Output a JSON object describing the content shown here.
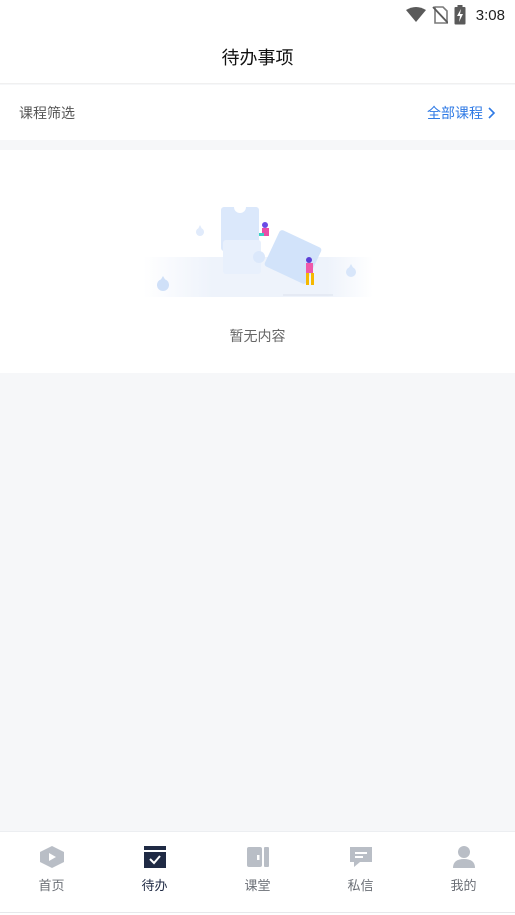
{
  "status_bar": {
    "time": "3:08",
    "icons": [
      "wifi-icon",
      "no-sim-icon",
      "battery-charging-icon"
    ]
  },
  "header": {
    "title": "待办事项"
  },
  "filter": {
    "label": "课程筛选",
    "value": "全部课程",
    "icon": "chevron-right-icon"
  },
  "empty_state": {
    "illustration": "puzzle-illustration",
    "text": "暂无内容"
  },
  "tabbar": {
    "active_index": 1,
    "tabs": [
      {
        "label": "首页",
        "icon": "home-icon"
      },
      {
        "label": "待办",
        "icon": "todo-icon"
      },
      {
        "label": "课堂",
        "icon": "classroom-icon"
      },
      {
        "label": "私信",
        "icon": "message-icon"
      },
      {
        "label": "我的",
        "icon": "profile-icon"
      }
    ]
  },
  "colors": {
    "accent": "#2f7ae5",
    "tab_active": "#1f2a44",
    "tab_inactive": "#b9bec6",
    "background": "#f6f7f9"
  }
}
